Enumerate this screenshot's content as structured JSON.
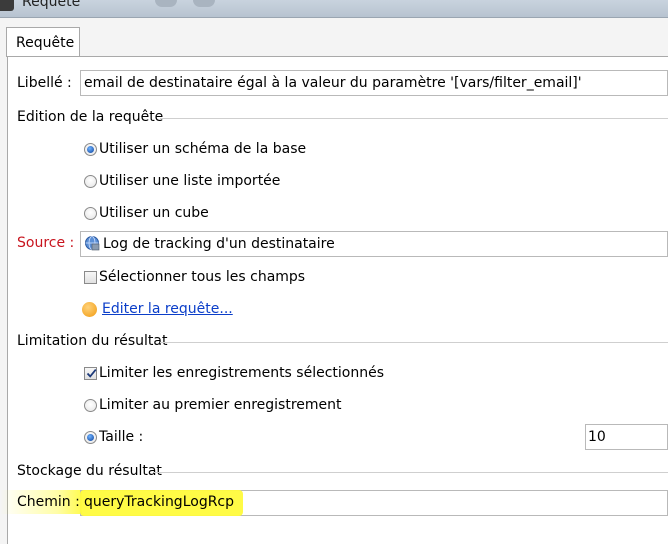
{
  "window": {
    "title": "Requête"
  },
  "tab": {
    "label": "Requête"
  },
  "libelle": {
    "label": "Libellé :",
    "value": "email de destinataire égal à la valeur du paramètre '[vars/filter_email]'"
  },
  "edition": {
    "group_title": "Edition de la requête",
    "options": [
      {
        "label": "Utiliser un schéma de la base",
        "checked": true
      },
      {
        "label": "Utiliser une liste importée",
        "checked": false
      },
      {
        "label": "Utiliser un cube",
        "checked": false
      }
    ],
    "source_label": "Source :",
    "source_value": "Log de tracking d'un destinataire",
    "select_all_label": "Sélectionner tous les champs",
    "select_all_checked": false,
    "edit_link": "Editer la requête..."
  },
  "limitation": {
    "group_title": "Limitation du résultat",
    "limit_selected_label": "Limiter les enregistrements sélectionnés",
    "limit_selected_checked": true,
    "options": [
      {
        "label": "Limiter au premier enregistrement",
        "checked": false
      },
      {
        "label": "Taille :",
        "checked": true
      }
    ],
    "size_value": "10"
  },
  "storage": {
    "group_title": "Stockage du résultat",
    "path_label": "Chemin :",
    "path_value": "queryTrackingLogRcp"
  },
  "colors": {
    "required_label": "#c8141e",
    "link": "#0b3ec9",
    "highlight": "#fffb3c"
  }
}
